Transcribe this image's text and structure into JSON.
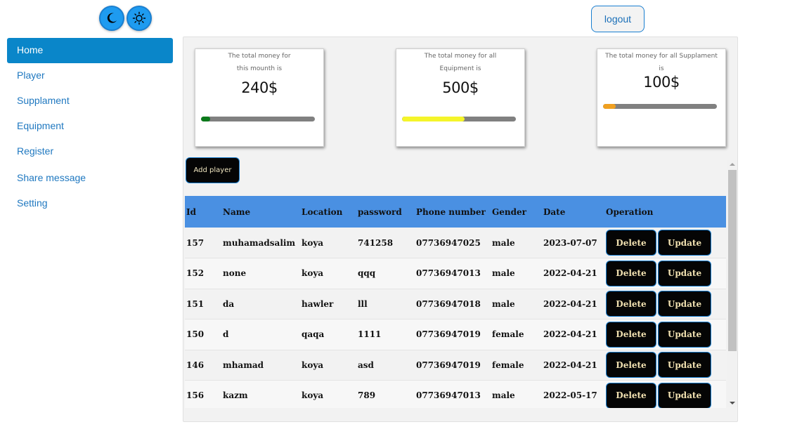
{
  "header": {
    "logout_label": "logout"
  },
  "sidebar": {
    "items": [
      {
        "label": "Home",
        "active": true
      },
      {
        "label": "Player"
      },
      {
        "label": "Supplament"
      },
      {
        "label": "Equipment"
      },
      {
        "label": "Register"
      },
      {
        "label": "Share message"
      },
      {
        "label": "Setting"
      }
    ]
  },
  "cards": [
    {
      "label_line1": "The total money for",
      "label_line2": "this mounth is",
      "amount": "240$",
      "progress": 0.08,
      "color": "#0a7a1a"
    },
    {
      "label_line1": "The total money for all",
      "label_line2": "Equipment is",
      "amount": "500$",
      "progress": 0.55,
      "color": "#f5f52a"
    },
    {
      "label_line1": "The total money for all Supplament is",
      "label_line2": "",
      "amount": "100$",
      "progress": 0.11,
      "color": "#f0a020"
    }
  ],
  "actions": {
    "add_player_label": "Add player"
  },
  "table": {
    "columns": [
      "Id",
      "Name",
      "Location",
      "password",
      "Phone number",
      "Gender",
      "Date",
      "Operation"
    ],
    "delete_label": "Delete",
    "update_label": "Update",
    "rows": [
      [
        "157",
        "muhamadsalim",
        "koya",
        "741258",
        "07736947025",
        "male",
        "2023-07-07"
      ],
      [
        "152",
        "none",
        "koya",
        "qqq",
        "07736947013",
        "male",
        "2022-04-21"
      ],
      [
        "151",
        "da",
        "hawler",
        "lll",
        "07736947018",
        "male",
        "2022-04-21"
      ],
      [
        "150",
        "d",
        "qaqa",
        "1111",
        "07736947019",
        "female",
        "2022-04-21"
      ],
      [
        "146",
        "mhamad",
        "koya",
        "asd",
        "07736947019",
        "female",
        "2022-04-21"
      ],
      [
        "156",
        "kazm",
        "koya",
        "789",
        "07736947013",
        "male",
        "2022-05-17"
      ]
    ]
  },
  "icons": {
    "dark_mode": "moon-icon",
    "light_mode": "sun-icon"
  },
  "colors": {
    "accent": "#0a86c9",
    "table_header": "#4a90e2",
    "button_bg": "#050505"
  }
}
